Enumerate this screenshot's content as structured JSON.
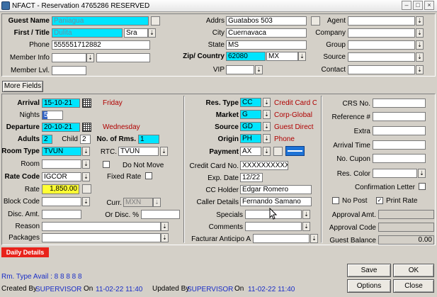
{
  "window": {
    "title": "NFACT - Reservation 4765286  RESERVED"
  },
  "guest": {
    "name_label": "Guest Name",
    "name_value": "Paniagua",
    "first_label": "First / Title",
    "first_value": "Dulita",
    "title_value": "Sra",
    "phone_label": "Phone",
    "phone_value": "555551712882",
    "member_info_label": "Member Info",
    "member_lvl_label": "Member Lvl."
  },
  "address": {
    "addrs_label": "Addrs",
    "addrs_value": "Guatabos 503",
    "city_label": "City",
    "city_value": "Cuernavaca",
    "state_label": "State",
    "state_value": "MS",
    "zip_label": "Zip/ Country",
    "zip_value": "62080",
    "country_value": "MX",
    "vip_label": "VIP"
  },
  "profile": {
    "agent_label": "Agent",
    "company_label": "Company",
    "group_label": "Group",
    "source_label": "Source",
    "contact_label": "Contact"
  },
  "more_fields_label": "More Fields",
  "stay": {
    "arrival_label": "Arrival",
    "arrival_value": "15-10-21",
    "arrival_day": "Friday",
    "nights_label": "Nights",
    "nights_value": "5",
    "departure_label": "Departure",
    "departure_value": "20-10-21",
    "departure_day": "Wednesday",
    "adults_label": "Adults",
    "adults_value": "2",
    "child_label": "Child",
    "child_value": "2",
    "rooms_label": "No. of Rms.",
    "rooms_value": "1",
    "room_type_label": "Room Type",
    "room_type_value": "TVUN",
    "rtc_label": "RTC.",
    "rtc_value": "TVUN",
    "room_label": "Room",
    "do_not_move_label": "Do Not Move",
    "fixed_rate_label": "Fixed Rate",
    "rate_code_label": "Rate Code",
    "rate_code_value": "IGCOR",
    "rate_label": "Rate",
    "rate_value": "1,850.00",
    "block_code_label": "Block Code",
    "curr_label": "Curr.",
    "curr_value": "MXN",
    "disc_amt_label": "Disc. Amt.",
    "or_disc_label": "Or Disc. %",
    "reason_label": "Reason",
    "packages_label": "Packages"
  },
  "payment": {
    "res_type_label": "Res. Type",
    "res_type_value": "CC",
    "res_type_desc": "Credit Card C",
    "market_label": "Market",
    "market_value": "G",
    "market_desc": "Corp-Global",
    "source_label": "Source",
    "source_value": "GD",
    "source_desc": "Guest Direct",
    "origin_label": "Origin",
    "origin_value": "PH",
    "origin_desc": "Phone",
    "payment_label": "Payment",
    "payment_value": "AX",
    "cc_no_label": "Credit Card No.",
    "cc_no_value": "XXXXXXXXXXXX",
    "exp_label": "Exp. Date",
    "exp_value": "12/22",
    "holder_label": "CC Holder",
    "holder_value": "Edgar Romero",
    "caller_label": "Caller Details",
    "caller_value": "Fernando Samano",
    "specials_label": "Specials",
    "comments_label": "Comments",
    "facturar_label": "Facturar Anticipo A"
  },
  "right": {
    "crs_label": "CRS No.",
    "reference_label": "Reference #",
    "extra_label": "Extra",
    "arrival_time_label": "Arrival Time",
    "cupon_label": "No. Cupon",
    "res_color_label": "Res. Color",
    "confirmation_label": "Confirmation Letter",
    "no_post_label": "No Post",
    "print_rate_label": "Print Rate",
    "approval_amt_label": "Approval Amt.",
    "approval_code_label": "Approval Code",
    "guest_balance_label": "Guest Balance",
    "guest_balance_value": "0.00"
  },
  "daily_details_label": "Daily Details",
  "footer": {
    "rm_avail": "Rm. Type Avail : 8 8 8 8 8",
    "created_by_label": "Created By",
    "created_by": "SUPERVISOR",
    "created_on_label": "On",
    "created_on": "11-02-22 11:40",
    "updated_by_label": "Updated By",
    "updated_by": "SUPERVISOR",
    "updated_on_label": "On",
    "updated_on": "11-02-22 11:40"
  },
  "buttons": {
    "save": "Save",
    "ok": "OK",
    "options": "Options",
    "close": "Close"
  },
  "colors": {
    "highlight": "#00e5ff",
    "rate": "#ffff33",
    "desc_text": "#b00000",
    "footer_text": "#1b2fc7",
    "daily_tab": "#e8231b"
  }
}
